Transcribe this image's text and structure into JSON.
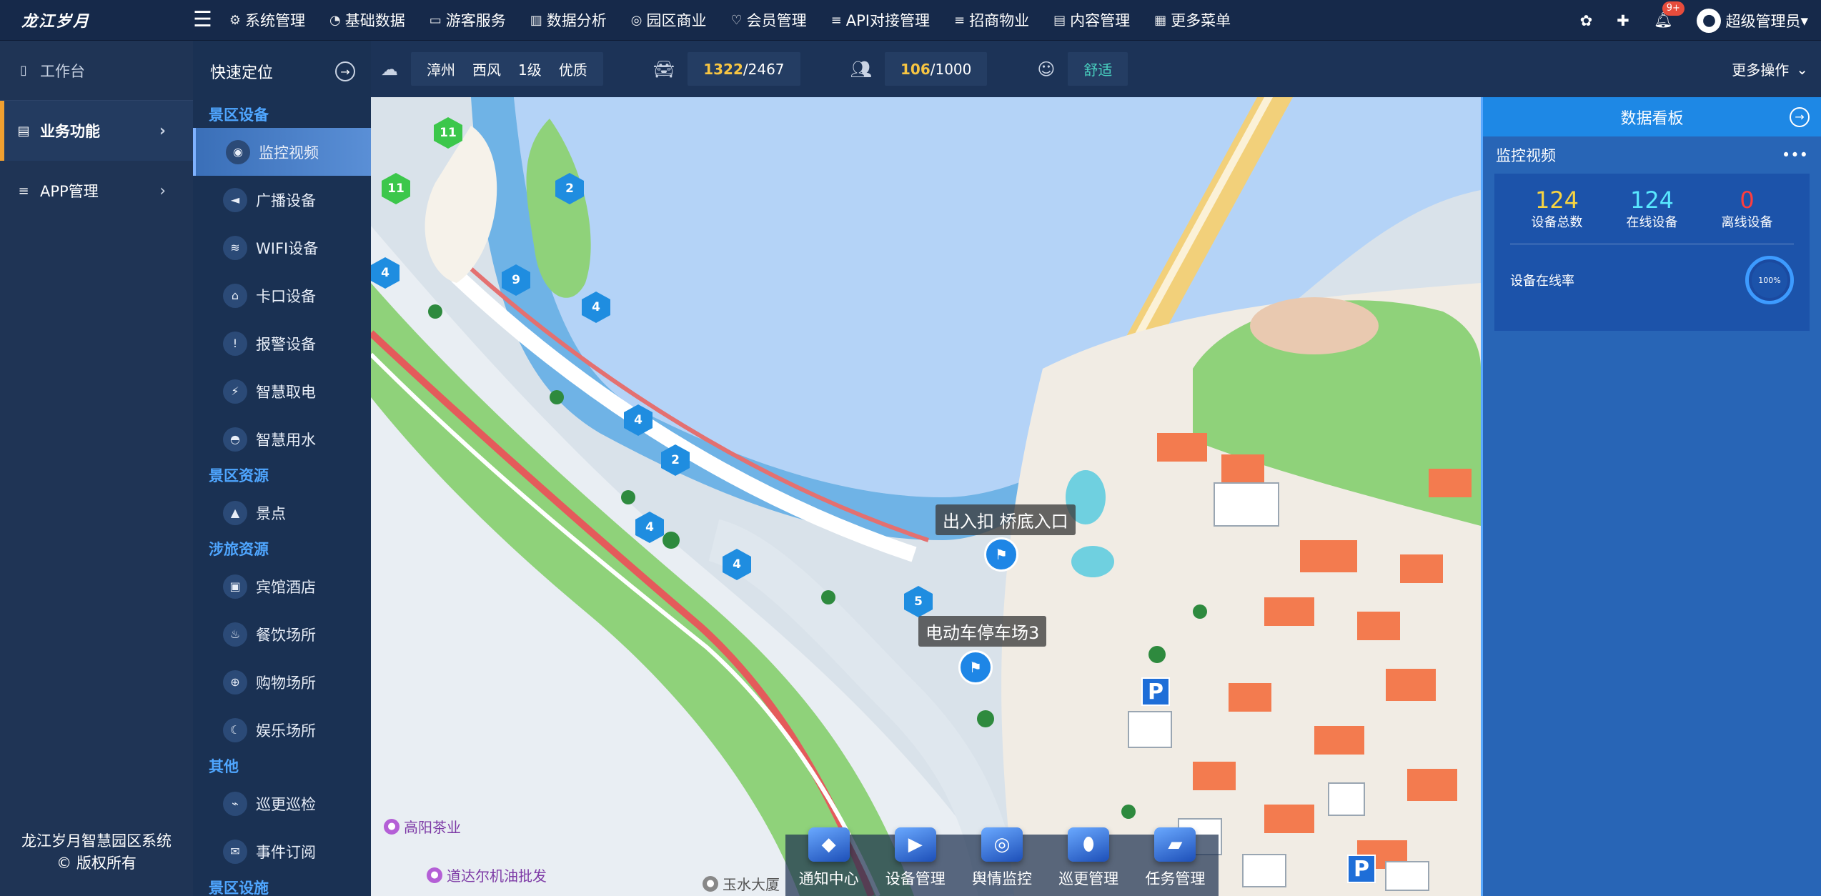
{
  "app": {
    "logo": "龙江岁月"
  },
  "topnav": [
    {
      "icon": "⚙",
      "label": "系统管理"
    },
    {
      "icon": "◔",
      "label": "基础数据"
    },
    {
      "icon": "▭",
      "label": "游客服务"
    },
    {
      "icon": "▥",
      "label": "数据分析"
    },
    {
      "icon": "◎",
      "label": "园区商业"
    },
    {
      "icon": "♡",
      "label": "会员管理"
    },
    {
      "icon": "≡",
      "label": "API对接管理"
    },
    {
      "icon": "≡",
      "label": "招商物业"
    },
    {
      "icon": "▤",
      "label": "内容管理"
    },
    {
      "icon": "▦",
      "label": "更多菜单"
    }
  ],
  "topright": {
    "badge": "9+",
    "user": "超级管理员"
  },
  "sidebar": {
    "items": [
      {
        "label": "工作台"
      },
      {
        "label": "业务功能"
      },
      {
        "label": "APP管理"
      }
    ],
    "footer_line1": "龙江岁月智慧园区系统",
    "footer_line2": "© 版权所有"
  },
  "quick": {
    "title": "快速定位",
    "groups": [
      {
        "name": "景区设备",
        "items": [
          "监控视频",
          "广播设备",
          "WIFI设备",
          "卡口设备",
          "报警设备",
          "智慧取电",
          "智慧用水"
        ]
      },
      {
        "name": "景区资源",
        "items": [
          "景点"
        ]
      },
      {
        "name": "涉旅资源",
        "items": [
          "宾馆酒店",
          "餐饮场所",
          "购物场所",
          "娱乐场所"
        ]
      },
      {
        "name": "其他",
        "items": [
          "巡更巡检",
          "事件订阅"
        ]
      },
      {
        "name": "景区设施",
        "items": []
      }
    ]
  },
  "status": {
    "weather": [
      "漳州",
      "西风",
      "1级",
      "优质"
    ],
    "cars_now": "1322",
    "cars_total": "/2467",
    "people_now": "106",
    "people_total": "/1000",
    "comfort": "舒适",
    "more": "更多操作"
  },
  "map": {
    "labels": [
      {
        "text": "出入扣 桥底入口"
      },
      {
        "text": "电动车停车场3"
      }
    ],
    "pois": [
      "高阳茶业",
      "道达尔机油批发",
      "玉水大厦"
    ],
    "clusters": [
      "11",
      "11",
      "2",
      "4",
      "9",
      "4",
      "4",
      "2",
      "4",
      "4",
      "5"
    ],
    "parking": "P"
  },
  "dock": [
    "通知中心",
    "设备管理",
    "舆情监控",
    "巡更管理",
    "任务管理"
  ],
  "panel": {
    "title": "数据看板",
    "section": "监控视频",
    "total_value": "124",
    "total_label": "设备总数",
    "online_value": "124",
    "online_label": "在线设备",
    "offline_value": "0",
    "offline_label": "离线设备",
    "rate_label": "设备在线率",
    "rate_value": "100%"
  },
  "colors": {
    "accent": "#1e88e5",
    "active_bar": "#f0a030",
    "highlight": "#4fa6ff"
  }
}
